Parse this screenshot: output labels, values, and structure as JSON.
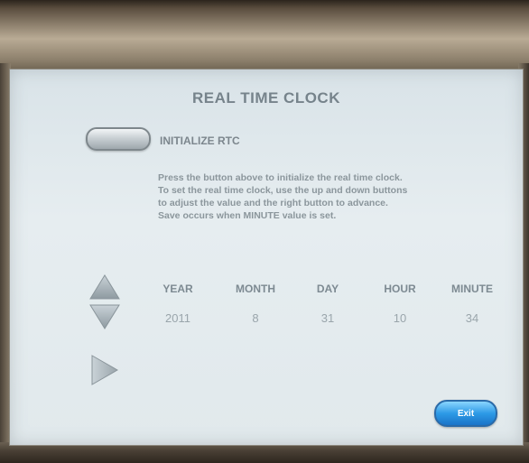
{
  "screen": {
    "title": "REAL TIME CLOCK",
    "initialize_label": "INITIALIZE RTC",
    "instructions": [
      "Press the button above to initialize the real time clock.",
      "To set the real time clock, use the up and down buttons",
      "to adjust the value and the right button to advance.",
      "Save occurs when MINUTE value is set."
    ],
    "fields": {
      "year": {
        "label": "YEAR",
        "value": "2011"
      },
      "month": {
        "label": "MONTH",
        "value": "8"
      },
      "day": {
        "label": "DAY",
        "value": "31"
      },
      "hour": {
        "label": "HOUR",
        "value": "10"
      },
      "minute": {
        "label": "MINUTE",
        "value": "34"
      }
    },
    "exit_label": "Exit"
  },
  "icons": {
    "up": "up-arrow-icon",
    "down": "down-arrow-icon",
    "right": "right-arrow-icon"
  },
  "colors": {
    "screen_bg": "#e3eaee",
    "text": "#7d8a92",
    "exit_button": "#2d9ae6"
  }
}
